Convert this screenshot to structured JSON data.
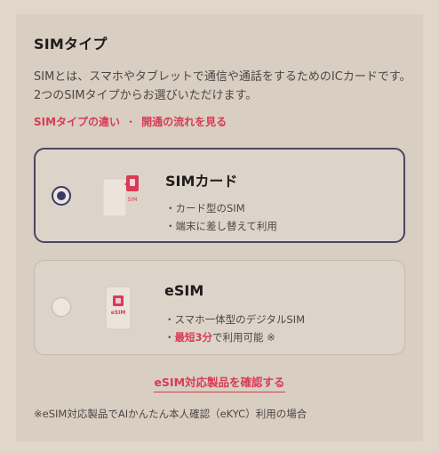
{
  "section": {
    "title": "SIMタイプ",
    "description": "SIMとは、スマホやタブレットで通信や通話をするためのICカードです。2つのSIMタイプからお選びいただけます。",
    "link_difference": "SIMタイプの違い",
    "link_separator": "・",
    "link_flow": "開通の流れを見る"
  },
  "options": [
    {
      "title": "SIMカード",
      "line1": "・カード型のSIM",
      "line2": "・端末に差し替えて利用",
      "icon_label": "SIM",
      "selected": true
    },
    {
      "title": "eSIM",
      "line1": "・スマホ一体型のデジタルSIM",
      "line2_prefix": "・",
      "line2_highlight": "最短3分",
      "line2_suffix": "で利用可能 ※",
      "icon_label": "eSIM",
      "selected": false
    }
  ],
  "check_link": "eSIM対応製品を確認する",
  "footnote": "※eSIM対応製品でAIかんたん本人確認（eKYC）利用の場合",
  "colors": {
    "accent": "#d83b56",
    "selected_border": "#4b4563",
    "radio_fill": "#3c3a66"
  }
}
